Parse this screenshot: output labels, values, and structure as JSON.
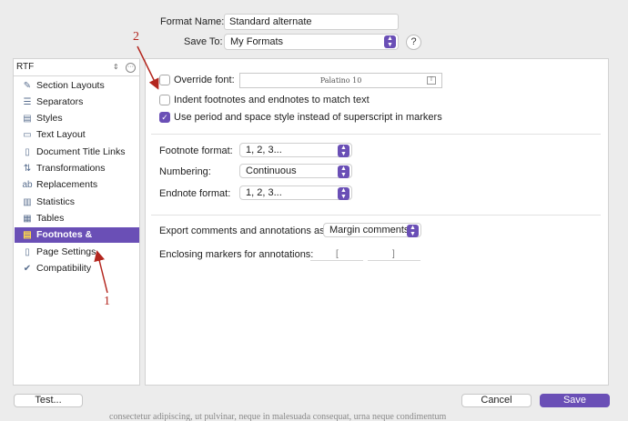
{
  "header": {
    "format_name_label": "Format Name:",
    "format_name_value": "Standard alternate",
    "save_to_label": "Save To:",
    "save_to_value": "My Formats",
    "help_label": "?"
  },
  "sidebar": {
    "format_type": "RTF",
    "items": [
      {
        "label": "Section Layouts",
        "icon": "pencil-icon",
        "glyph": "✎"
      },
      {
        "label": "Separators",
        "icon": "separators-icon",
        "glyph": "☰"
      },
      {
        "label": "Styles",
        "icon": "styles-icon",
        "glyph": "▤"
      },
      {
        "label": "Text Layout",
        "icon": "text-layout-icon",
        "glyph": "▭"
      },
      {
        "label": "Document Title Links",
        "icon": "links-icon",
        "glyph": "▯"
      },
      {
        "label": "Transformations",
        "icon": "transform-icon",
        "glyph": "⇅"
      },
      {
        "label": "Replacements",
        "icon": "replace-icon",
        "glyph": "ab"
      },
      {
        "label": "Statistics",
        "icon": "stats-icon",
        "glyph": "▥"
      },
      {
        "label": "Tables",
        "icon": "table-icon",
        "glyph": "▦"
      },
      {
        "label": "Footnotes & Comments",
        "icon": "comment-icon",
        "glyph": "▤"
      },
      {
        "label": "Page Settings",
        "icon": "page-icon",
        "glyph": "▯"
      },
      {
        "label": "Compatibility",
        "icon": "compat-icon",
        "glyph": "✔"
      }
    ],
    "active_index": 9
  },
  "main": {
    "override_font_label": "Override font:",
    "font_value": "Palatino 10",
    "font_button": "T",
    "indent_label": "Indent footnotes and endnotes to match text",
    "period_space_label": "Use period and space style instead of superscript in markers",
    "footnote_format_label": "Footnote format:",
    "footnote_format_value": "1, 2, 3...",
    "numbering_label": "Numbering:",
    "numbering_value": "Continuous",
    "endnote_format_label": "Endnote format:",
    "endnote_format_value": "1, 2, 3...",
    "export_comments_label": "Export comments and annotations as:",
    "export_comments_value": "Margin comments",
    "enclosing_markers_label": "Enclosing markers for annotations:",
    "marker_open": "[",
    "marker_close": "]",
    "checkboxes": {
      "override_font": false,
      "indent": false,
      "period_space": true
    }
  },
  "footer": {
    "test_label": "Test...",
    "cancel_label": "Cancel",
    "save_label": "Save"
  },
  "annotations": {
    "arrow_1_label": "1",
    "arrow_2_label": "2",
    "color": "#b3261e"
  },
  "background_text": "consectetur adipiscing, ut pulvinar, neque in malesuada consequat, urna neque condimentum"
}
